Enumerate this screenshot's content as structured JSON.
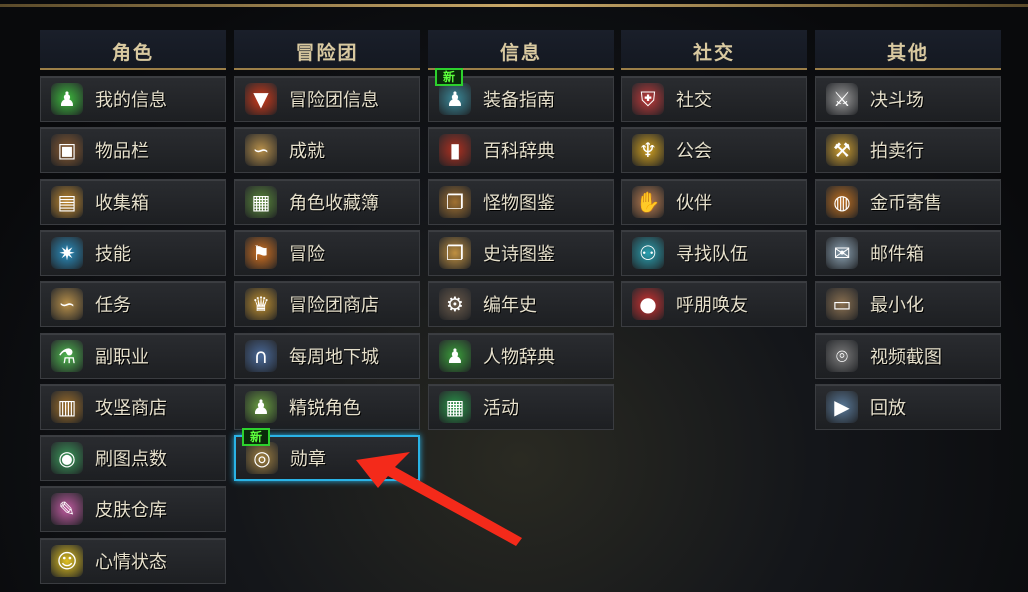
{
  "new_badge": "新",
  "columns": [
    {
      "title": "角色",
      "items": [
        {
          "label": "我的信息",
          "icon": "green-figure-icon",
          "color": "#3dbb3d",
          "glyph": "♟"
        },
        {
          "label": "物品栏",
          "icon": "backpack-icon",
          "color": "#8a5a30",
          "glyph": "▣"
        },
        {
          "label": "收集箱",
          "icon": "treasure-box-icon",
          "color": "#c28a30",
          "glyph": "▤"
        },
        {
          "label": "技能",
          "icon": "skill-burst-icon",
          "color": "#2a8fc0",
          "glyph": "✷"
        },
        {
          "label": "任务",
          "icon": "scroll-icon",
          "color": "#b8904a",
          "glyph": "∽"
        },
        {
          "label": "副职业",
          "icon": "potion-icon",
          "color": "#4fb84f",
          "glyph": "⚗"
        },
        {
          "label": "攻坚商店",
          "icon": "chest-icon",
          "color": "#a0702a",
          "glyph": "▥"
        },
        {
          "label": "刷图点数",
          "icon": "potion-orb-icon",
          "color": "#3a9a5a",
          "glyph": "◉"
        },
        {
          "label": "皮肤仓库",
          "icon": "brush-icon",
          "color": "#c05aa0",
          "glyph": "✎"
        },
        {
          "label": "心情状态",
          "icon": "smiley-icon",
          "color": "#e0c020",
          "glyph": "☺"
        }
      ]
    },
    {
      "title": "冒险团",
      "items": [
        {
          "label": "冒险团信息",
          "icon": "banner-icon",
          "color": "#d03a1a",
          "glyph": "▼"
        },
        {
          "label": "成就",
          "icon": "scroll-icon",
          "color": "#b8904a",
          "glyph": "∽"
        },
        {
          "label": "角色收藏簿",
          "icon": "card-book-icon",
          "color": "#5a8a3a",
          "glyph": "▦"
        },
        {
          "label": "冒险",
          "icon": "flag-icon",
          "color": "#d07020",
          "glyph": "⚑"
        },
        {
          "label": "冒险团商店",
          "icon": "gift-shop-icon",
          "color": "#c09030",
          "glyph": "♛"
        },
        {
          "label": "每周地下城",
          "icon": "portal-arch-icon",
          "color": "#4a6a9a",
          "glyph": "∩"
        },
        {
          "label": "精锐角色",
          "icon": "elite-figure-icon",
          "color": "#6aa040",
          "glyph": "♟"
        },
        {
          "label": "勋章",
          "icon": "medal-icon",
          "color": "#a08040",
          "glyph": "◎",
          "new": true,
          "selected": true
        }
      ]
    },
    {
      "title": "信息",
      "items": [
        {
          "label": "装备指南",
          "icon": "guide-book-icon",
          "color": "#3a8a9a",
          "glyph": "♟",
          "new": true
        },
        {
          "label": "百科辞典",
          "icon": "red-book-icon",
          "color": "#b03020",
          "glyph": "▮"
        },
        {
          "label": "怪物图鉴",
          "icon": "monster-book-icon",
          "color": "#a07030",
          "glyph": "❐"
        },
        {
          "label": "史诗图鉴",
          "icon": "epic-book-icon",
          "color": "#c09040",
          "glyph": "❐"
        },
        {
          "label": "编年史",
          "icon": "gear-icon",
          "color": "#6a5a4a",
          "glyph": "⚙"
        },
        {
          "label": "人物辞典",
          "icon": "character-book-icon",
          "color": "#3aa03a",
          "glyph": "♟"
        },
        {
          "label": "活动",
          "icon": "calendar-icon",
          "color": "#2a9a4a",
          "glyph": "▦"
        }
      ]
    },
    {
      "title": "社交",
      "items": [
        {
          "label": "社交",
          "icon": "shield-icon",
          "color": "#c03a3a",
          "glyph": "⛨"
        },
        {
          "label": "公会",
          "icon": "eagle-emblem-icon",
          "color": "#d0a020",
          "glyph": "♆"
        },
        {
          "label": "伙伴",
          "icon": "handshake-icon",
          "color": "#c08050",
          "glyph": "✋"
        },
        {
          "label": "寻找队伍",
          "icon": "team-icon",
          "color": "#2aa0b0",
          "glyph": "⚇"
        },
        {
          "label": "呼朋唤友",
          "icon": "penguin-icon",
          "color": "#d03030",
          "glyph": "●"
        }
      ]
    },
    {
      "title": "其他",
      "items": [
        {
          "label": "决斗场",
          "icon": "crossed-swords-icon",
          "color": "#9a9a9a",
          "glyph": "⚔"
        },
        {
          "label": "拍卖行",
          "icon": "gavel-icon",
          "color": "#d0a030",
          "glyph": "⚒"
        },
        {
          "label": "金币寄售",
          "icon": "gold-bag-icon",
          "color": "#c07020",
          "glyph": "◍"
        },
        {
          "label": "邮件箱",
          "icon": "mail-icon",
          "color": "#8aa0b0",
          "glyph": "✉"
        },
        {
          "label": "最小化",
          "icon": "minimize-icon",
          "color": "#8a7050",
          "glyph": "▭"
        },
        {
          "label": "视频截图",
          "icon": "camera-icon",
          "color": "#7a7a7a",
          "glyph": "⌾"
        },
        {
          "label": "回放",
          "icon": "replay-icon",
          "color": "#5a7a9a",
          "glyph": "▶"
        }
      ]
    }
  ]
}
